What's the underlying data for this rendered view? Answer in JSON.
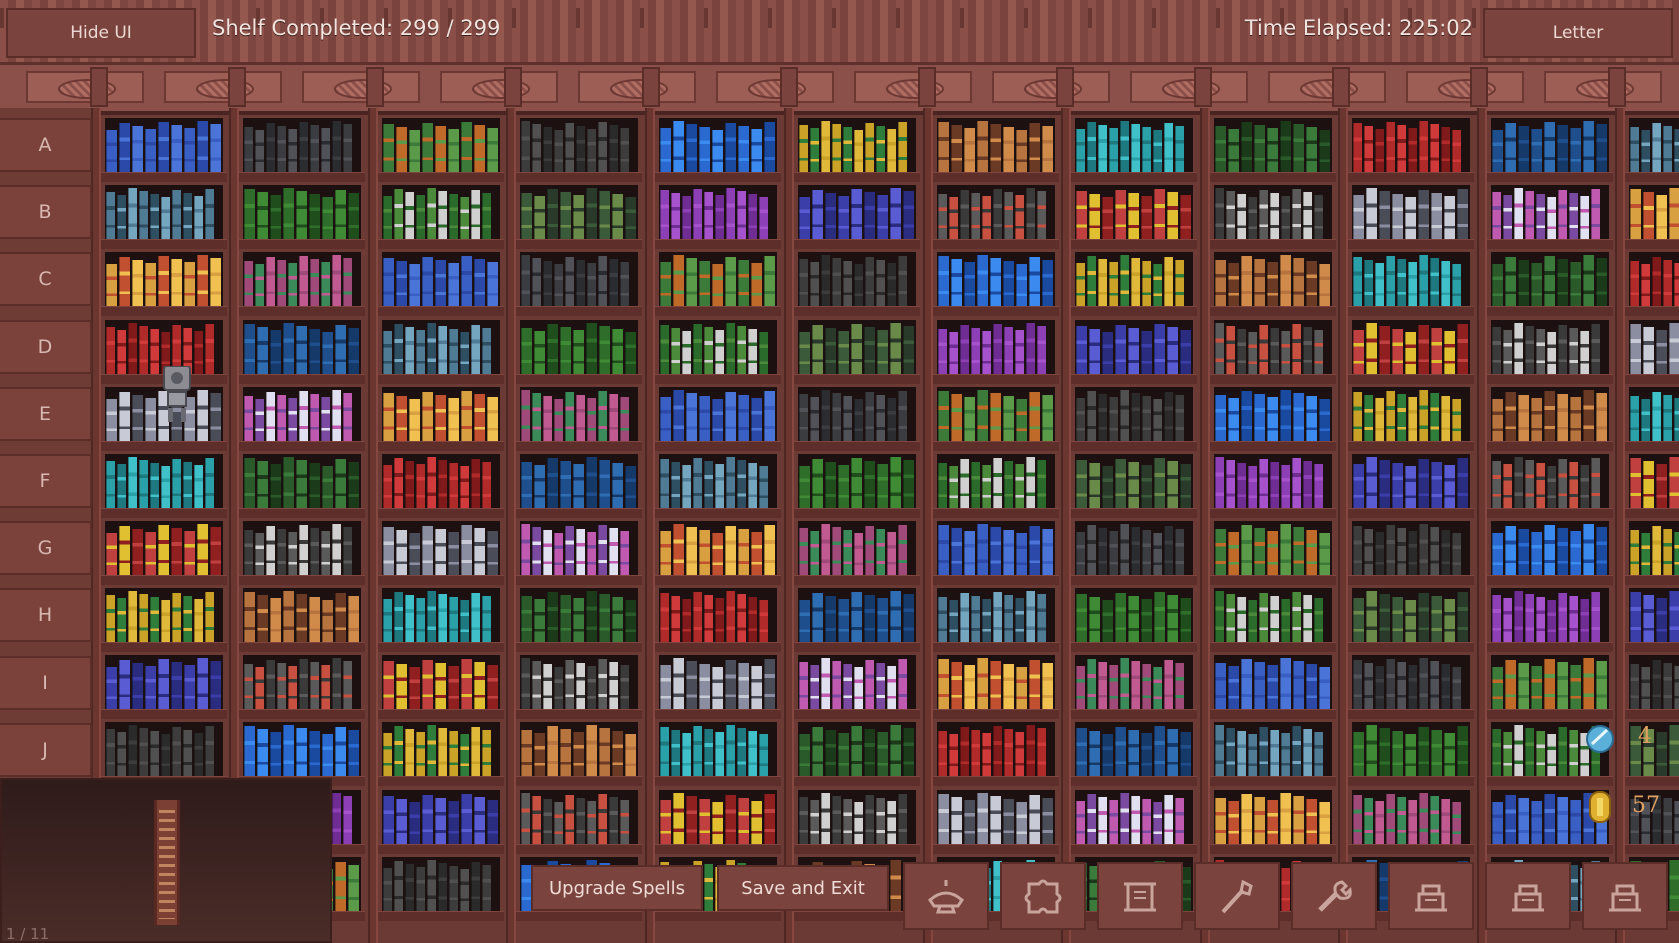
{
  "hud": {
    "hide_ui_label": "Hide UI",
    "shelf_completed_label": "Shelf Completed:",
    "shelf_completed_value": "299 / 299",
    "time_elapsed_label": "Time Elapsed:",
    "time_elapsed_value": "225:02",
    "letter_label": "Letter"
  },
  "rows": [
    "A",
    "B",
    "C",
    "D",
    "E",
    "F",
    "G",
    "H",
    "I",
    "J"
  ],
  "bottom_bar": {
    "upgrade_spells_label": "Upgrade Spells",
    "save_and_exit_label": "Save and Exit",
    "tools": [
      "lamp-icon",
      "puzzle-icon",
      "scroll-icon",
      "wand-icon",
      "wrench-icon",
      "shrine-icon",
      "shrine-icon",
      "shrine-icon"
    ]
  },
  "minimap": {
    "page_indicator": "1 / 11"
  },
  "resources": {
    "gems": "4",
    "coins": "57"
  },
  "colors": {
    "frame": "#7a433d",
    "shelf_background": "#1c1010",
    "text": "#f1e3de"
  },
  "shelf_palettes": [
    [
      "#3a5fc4",
      "#2a49a8",
      "#4b74d8"
    ],
    [
      "#c9a227",
      "#2f7d3a",
      "#e0b83a"
    ],
    [
      "#1e4e8c",
      "#2f6db3",
      "#153a6a"
    ],
    [
      "#8d3fb5",
      "#a552cc",
      "#6f2d94"
    ],
    [
      "#8a8ea0",
      "#c8cad6",
      "#4a4c58"
    ],
    [
      "#3a3c40",
      "#505258",
      "#2b2c30"
    ],
    [
      "#b8743e",
      "#6a3a24",
      "#d08a4a"
    ],
    [
      "#4f7b95",
      "#2e4e62",
      "#74a6c0"
    ],
    [
      "#3b3ea8",
      "#5a5cd4",
      "#2a2c80"
    ],
    [
      "#c05ab0",
      "#7a4aa0",
      "#e0e0f0"
    ],
    [
      "#3c7a3a",
      "#c06a2a",
      "#5a9a48"
    ],
    [
      "#2aa0a8",
      "#1e7880",
      "#40c0c8"
    ],
    [
      "#2f6e2a",
      "#3f8a34",
      "#1f4e1c"
    ],
    [
      "#5a5a5a",
      "#c85040",
      "#3a3a3a"
    ],
    [
      "#d8a040",
      "#c05030",
      "#f0c050"
    ],
    [
      "#3c3c3c",
      "#505050",
      "#2a2a2a"
    ],
    [
      "#2a5a2a",
      "#3a7a3a",
      "#1a3a1a"
    ],
    [
      "#2a6a2a",
      "#4a8a3a",
      "#d0d0d0"
    ],
    [
      "#c04040",
      "#e0c030",
      "#902020"
    ],
    [
      "#a04a7a",
      "#3a8a5a",
      "#c05a90"
    ],
    [
      "#2a6ad0",
      "#3a8af0",
      "#1a4aa0"
    ],
    [
      "#b02a2a",
      "#d03a3a",
      "#801a1a"
    ],
    [
      "#3a5a3a",
      "#6a8a4a",
      "#2a3a2a"
    ],
    [
      "#3a3a3a",
      "#5a5a5a",
      "#d0d0d0"
    ]
  ]
}
